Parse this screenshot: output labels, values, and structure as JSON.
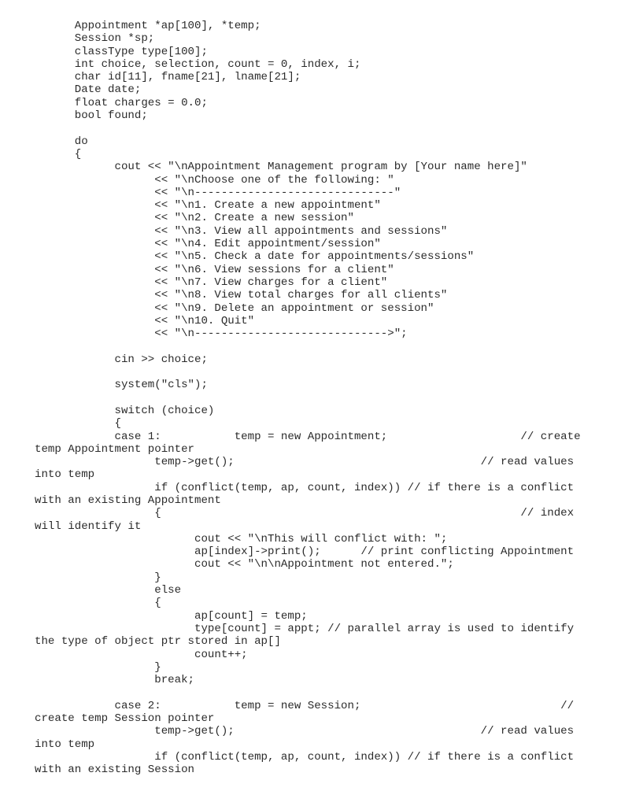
{
  "document": {
    "language": "C++",
    "lines": [
      "      Appointment *ap[100], *temp;",
      "      Session *sp;",
      "      classType type[100];",
      "      int choice, selection, count = 0, index, i;",
      "      char id[11], fname[21], lname[21];",
      "      Date date;",
      "      float charges = 0.0;",
      "      bool found;",
      "",
      "      do",
      "      {",
      "            cout << \"\\nAppointment Management program by [Your name here]\"",
      "                  << \"\\nChoose one of the following: \"",
      "                  << \"\\n------------------------------\"",
      "                  << \"\\n1. Create a new appointment\"",
      "                  << \"\\n2. Create a new session\"",
      "                  << \"\\n3. View all appointments and sessions\"",
      "                  << \"\\n4. Edit appointment/session\"",
      "                  << \"\\n5. Check a date for appointments/sessions\"",
      "                  << \"\\n6. View sessions for a client\"",
      "                  << \"\\n7. View charges for a client\"",
      "                  << \"\\n8. View total charges for all clients\"",
      "                  << \"\\n9. Delete an appointment or session\"",
      "                  << \"\\n10. Quit\"",
      "                  << \"\\n----------------------------->\";",
      "",
      "            cin >> choice;",
      "",
      "            system(\"cls\");",
      "",
      "            switch (choice)",
      "            {",
      "            case 1:           temp = new Appointment;                    // create",
      "temp Appointment pointer",
      "                  temp->get();                                     // read values",
      "into temp",
      "                  if (conflict(temp, ap, count, index)) // if there is a conflict",
      "with an existing Appointment",
      "                  {                                                      // index",
      "will identify it",
      "                        cout << \"\\nThis will conflict with: \";",
      "                        ap[index]->print();      // print conflicting Appointment",
      "                        cout << \"\\n\\nAppointment not entered.\";",
      "                  }",
      "                  else",
      "                  {",
      "                        ap[count] = temp;",
      "                        type[count] = appt; // parallel array is used to identify",
      "the type of object ptr stored in ap[]",
      "                        count++;",
      "                  }",
      "                  break;",
      "",
      "            case 2:           temp = new Session;                              //",
      "create temp Session pointer",
      "                  temp->get();                                     // read values",
      "into temp",
      "                  if (conflict(temp, ap, count, index)) // if there is a conflict",
      "with an existing Session"
    ]
  }
}
